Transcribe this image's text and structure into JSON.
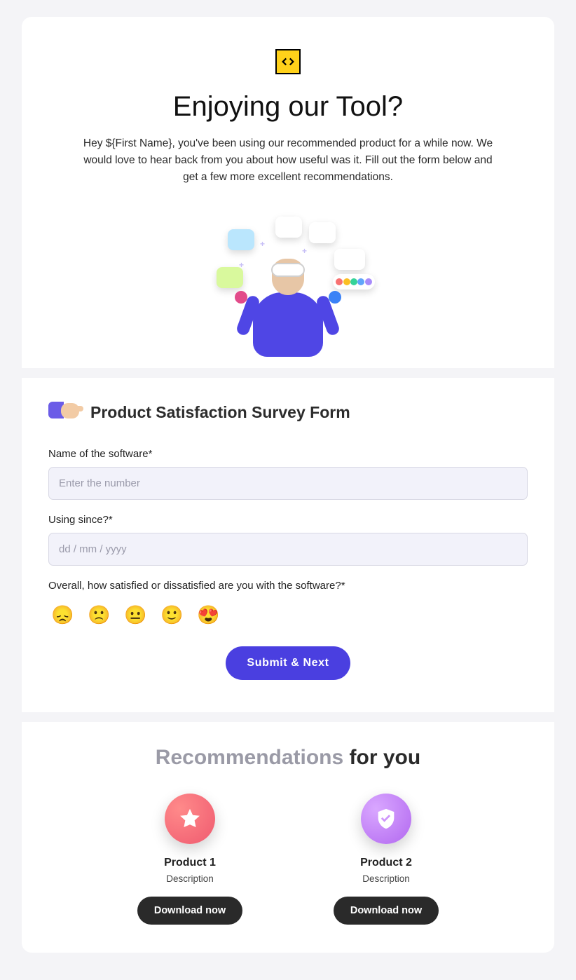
{
  "header": {
    "title": "Enjoying our Tool?",
    "intro": "Hey ${First Name}, you've been using our recommended product for a while now. We would love to hear back from you about how useful was it. Fill out the form below and get a few more excellent recommendations."
  },
  "form": {
    "title": "Product Satisfaction Survey Form",
    "fields": {
      "software_name": {
        "label": "Name of the software*",
        "placeholder": "Enter the number",
        "value": ""
      },
      "using_since": {
        "label": "Using since?*",
        "placeholder": "dd / mm / yyyy",
        "value": ""
      },
      "satisfaction": {
        "label": "Overall, how satisfied or dissatisfied are you with the software?*"
      }
    },
    "emojis": [
      "😞",
      "🙁",
      "😐",
      "🙂",
      "😍"
    ],
    "submit_label": "Submit & Next"
  },
  "recommendations": {
    "title_accent": "Recommendations",
    "title_rest": " for you",
    "products": [
      {
        "title": "Product 1",
        "desc": "Description",
        "button": "Download now"
      },
      {
        "title": "Product 2",
        "desc": "Description",
        "button": "Download now"
      }
    ]
  }
}
